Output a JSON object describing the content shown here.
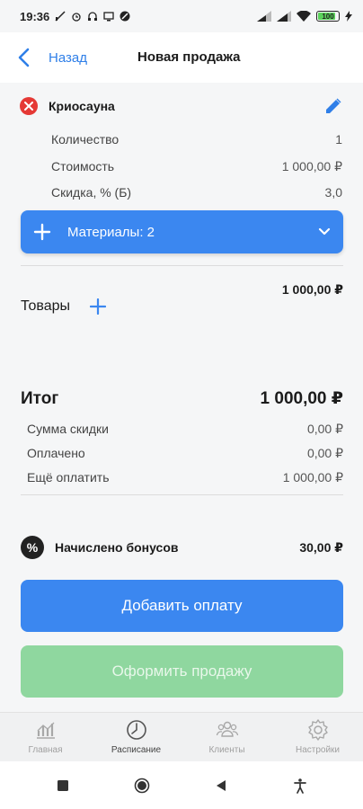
{
  "status_bar": {
    "time": "19:36",
    "battery": "100"
  },
  "header": {
    "back_label": "Назад",
    "title": "Новая продажа"
  },
  "service": {
    "name": "Криосауна",
    "details": [
      {
        "label": "Количество",
        "value": "1"
      },
      {
        "label": "Стоимость",
        "value": "1 000,00 ₽"
      },
      {
        "label": "Скидка, % (Б)",
        "value": "3,0"
      }
    ],
    "materials_label": "Материалы: 2"
  },
  "subtotal": "1 000,00 ₽",
  "goods": {
    "label": "Товары"
  },
  "summary": {
    "total_label": "Итог",
    "total_value": "1 000,00 ₽",
    "rows": [
      {
        "label": "Сумма скидки",
        "value": "0,00 ₽"
      },
      {
        "label": "Оплачено",
        "value": "0,00 ₽"
      },
      {
        "label": "Ещё оплатить",
        "value": "1 000,00 ₽"
      }
    ]
  },
  "bonus": {
    "icon": "%",
    "label": "Начислено бонусов",
    "value": "30,00 ₽"
  },
  "actions": {
    "add_payment": "Добавить оплату",
    "checkout": "Оформить продажу"
  },
  "bottom_nav": [
    {
      "label": "Главная",
      "icon": "chart-icon"
    },
    {
      "label": "Расписание",
      "icon": "clock-icon"
    },
    {
      "label": "Клиенты",
      "icon": "clients-icon"
    },
    {
      "label": "Настройки",
      "icon": "gear-icon"
    }
  ],
  "colors": {
    "accent": "#3b87f0",
    "danger": "#e53935",
    "success_disabled": "#8fd79f"
  }
}
